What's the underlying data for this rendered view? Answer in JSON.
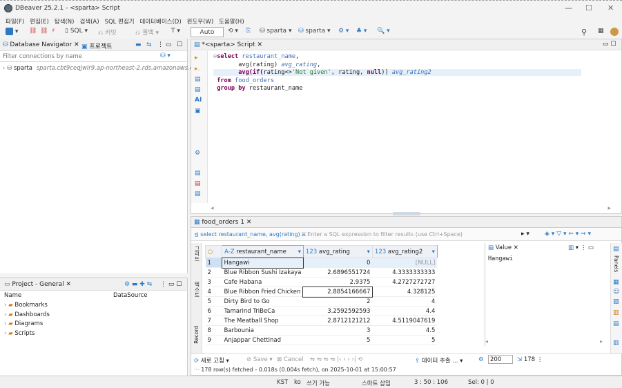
{
  "window": {
    "title": "DBeaver 25.2.1 - <sparta> Script"
  },
  "menu": [
    "파일(F)",
    "편집(E)",
    "탐색(N)",
    "검색(A)",
    "SQL 편집기",
    "데이터베이스(D)",
    "윈도우(W)",
    "도움말(H)"
  ],
  "toolbar": {
    "sql_label": "SQL",
    "commit_label": "커밋",
    "rollback_label": "롤백",
    "mode": "Auto",
    "datasource": "sparta",
    "schema": "sparta"
  },
  "navigator": {
    "tab_label": "Database Navigator",
    "projects_tab": "프로젝트",
    "filter_placeholder": "Filter connections by name",
    "connection_name": "sparta",
    "connection_host": "sparta.cbt9ceqjwlr9.ap-northeast-2.rds.amazonaws.co..."
  },
  "project": {
    "tab_label": "Project - General",
    "col_name": "Name",
    "col_datasource": "DataSource",
    "items": [
      "Bookmarks",
      "Dashboards",
      "Diagrams",
      "Scripts"
    ]
  },
  "editor": {
    "tab_label": "*<sparta> Script"
  },
  "results": {
    "tab_label": "food_orders 1",
    "query_preview": "select restaurant_name, avg(rating) a",
    "filter_placeholder": "Enter a SQL expression to filter results (use Ctrl+Space)",
    "columns": [
      "restaurant_name",
      "avg_rating",
      "avg_rating2"
    ],
    "col_types": [
      "A-Z",
      "123",
      "123"
    ],
    "rows": [
      [
        "1",
        "Hangawi",
        "0",
        "[NULL]"
      ],
      [
        "2",
        "Blue Ribbon Sushi Izakaya",
        "2.6896551724",
        "4.3333333333"
      ],
      [
        "3",
        "Cafe Habana",
        "2.9375",
        "4.2727272727"
      ],
      [
        "4",
        "Blue Ribbon Fried Chicken",
        "2.8854166667",
        "4.328125"
      ],
      [
        "5",
        "Dirty Bird to Go",
        "2",
        "4"
      ],
      [
        "6",
        "Tamarind TriBeCa",
        "3.2592592593",
        "4.4"
      ],
      [
        "7",
        "The Meatball Shop",
        "2.8712121212",
        "4.5119047619"
      ],
      [
        "8",
        "Barbounia",
        "3",
        "4.5"
      ],
      [
        "9",
        "Anjappar Chettinad",
        "5",
        "5"
      ]
    ],
    "side_tabs": [
      "그리드",
      "텍스트",
      "Record"
    ],
    "refresh_label": "새로 고침",
    "save_label": "Save",
    "cancel_label": "Cancel",
    "export_label": "데이터 추출 ...",
    "fetch_size": "200",
    "row_count": "178",
    "fetch_status": "178 row(s) fetched - 0.018s (0.004s fetch), on 2025-10-01 at 15:00:57"
  },
  "value_panel": {
    "tab_label": "Value",
    "value": "Hangawi",
    "panels_label": "Panels"
  },
  "status": {
    "tz": "KST",
    "locale": "ko",
    "write": "쓰기 가능",
    "insert": "스마트 삽입",
    "pos": "3 : 50 : 106",
    "sel": "Sel: 0 | 0"
  }
}
